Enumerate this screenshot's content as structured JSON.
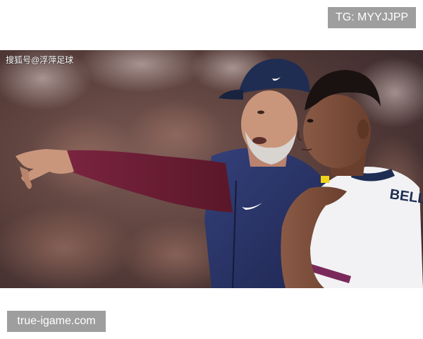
{
  "watermark_top": "TG: MYYJJPP",
  "source_label": "搜狐号@浮萍足球",
  "watermark_bottom": "true-igame.com",
  "photo": {
    "subject": "coach pointing beside a player in a stadium",
    "shirt_lettering": "BELL",
    "colors": {
      "crowd": "#6b4a44",
      "cap": "#1f2d52",
      "sleeve": "#6e1d33",
      "vest": "#2a3563",
      "skin": "#c9967c",
      "player_shirt": "#f2f2f4",
      "badge_bg": "#9e9e9e"
    }
  }
}
